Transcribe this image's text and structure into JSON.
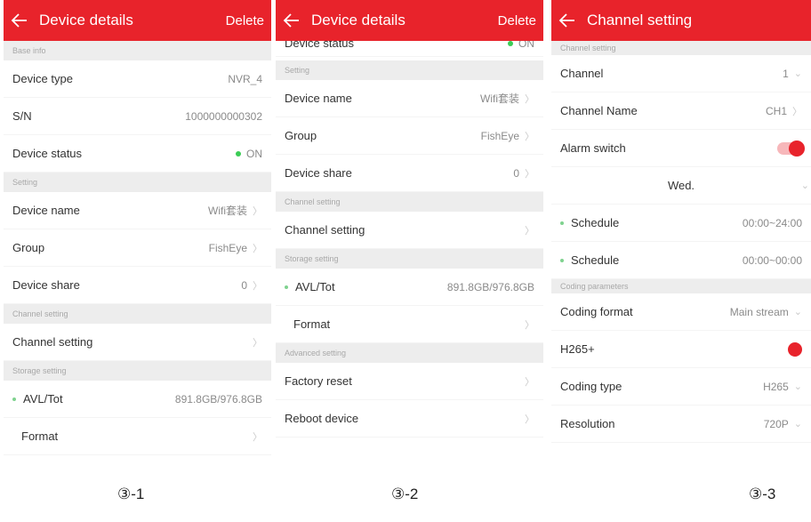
{
  "screen1": {
    "title": "Device details",
    "action": "Delete",
    "sections": {
      "base": "Base info",
      "setting": "Setting",
      "channel": "Channel setting",
      "storage": "Storage setting"
    },
    "rows": {
      "device_type": {
        "label": "Device type",
        "value": "NVR_4"
      },
      "sn": {
        "label": "S/N",
        "value": "1000000000302"
      },
      "device_status": {
        "label": "Device status",
        "value": "ON"
      },
      "device_name": {
        "label": "Device name",
        "value": "Wifi套装"
      },
      "group": {
        "label": "Group",
        "value": "FishEye"
      },
      "device_share": {
        "label": "Device share",
        "value": "0"
      },
      "channel_setting": {
        "label": "Channel setting"
      },
      "avl_tot": {
        "label": "AVL/Tot",
        "value": "891.8GB/976.8GB"
      },
      "format": {
        "label": "Format"
      }
    },
    "caption": "③-1"
  },
  "screen2": {
    "title": "Device details",
    "action": "Delete",
    "sections": {
      "setting": "Setting",
      "channel": "Channel setting",
      "storage": "Storage setting",
      "advanced": "Advanced setting"
    },
    "rows": {
      "device_status": {
        "label": "Device status",
        "value": "ON"
      },
      "device_name": {
        "label": "Device name",
        "value": "Wifi套装"
      },
      "group": {
        "label": "Group",
        "value": "FishEye"
      },
      "device_share": {
        "label": "Device share",
        "value": "0"
      },
      "channel_setting": {
        "label": "Channel setting"
      },
      "avl_tot": {
        "label": "AVL/Tot",
        "value": "891.8GB/976.8GB"
      },
      "format": {
        "label": "Format"
      },
      "factory_reset": {
        "label": "Factory reset"
      },
      "reboot": {
        "label": "Reboot device"
      }
    },
    "caption": "③-2"
  },
  "screen3": {
    "title": "Channel setting",
    "sections": {
      "channel": "Channel setting",
      "coding": "Coding parameters"
    },
    "rows": {
      "channel": {
        "label": "Channel",
        "value": "1"
      },
      "channel_name": {
        "label": "Channel Name",
        "value": "CH1"
      },
      "alarm_switch": {
        "label": "Alarm switch",
        "on": true
      },
      "day": {
        "value": "Wed."
      },
      "schedule1": {
        "label": "Schedule",
        "value": "00:00~24:00"
      },
      "schedule2": {
        "label": "Schedule",
        "value": "00:00~00:00"
      },
      "coding_format": {
        "label": "Coding format",
        "value": "Main stream"
      },
      "h265plus": {
        "label": "H265+",
        "on": true
      },
      "coding_type": {
        "label": "Coding type",
        "value": "H265"
      },
      "resolution": {
        "label": "Resolution",
        "value": "720P"
      }
    },
    "caption": "③-3"
  },
  "icons": {
    "back": "back-arrow-icon",
    "chevron": "chevron-right-icon",
    "dropdown": "chevron-down-icon"
  },
  "colors": {
    "accent": "#e8232b",
    "status_on": "#3bcc55",
    "section_bg": "#ededed"
  }
}
